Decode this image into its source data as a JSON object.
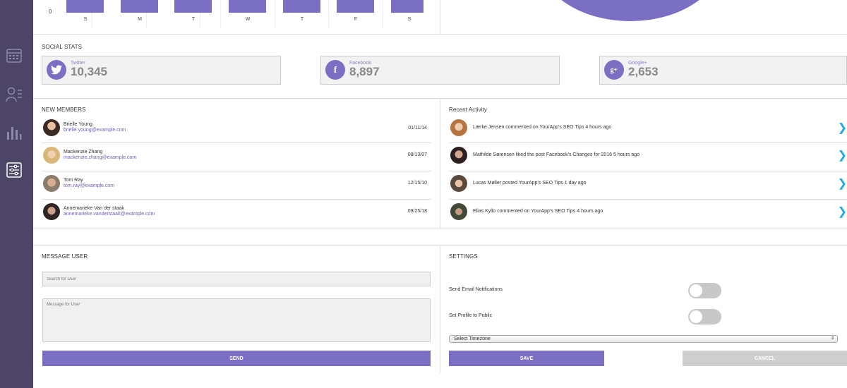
{
  "chart": {
    "y_zero": "0",
    "days": [
      "S",
      "M",
      "T",
      "W",
      "T",
      "F",
      "S"
    ]
  },
  "social": {
    "title": "SOCIAL STATS",
    "cards": [
      {
        "network": "Twitter",
        "count": "10,345",
        "icon": "twitter-icon"
      },
      {
        "network": "Facebook",
        "count": "8,897",
        "icon": "facebook-icon"
      },
      {
        "network": "Google+",
        "count": "2,653",
        "icon": "google-plus-icon"
      }
    ]
  },
  "members": {
    "title": "NEW MEMBERS",
    "items": [
      {
        "name": "Brielle Young",
        "email": "brielle.young@example.com",
        "date": "01/11/14"
      },
      {
        "name": "Mackenzie Zhang",
        "email": "mackenzie.zhang@example.com",
        "date": "08/13/07"
      },
      {
        "name": "Tom Ray",
        "email": "tom.ray@example.com",
        "date": "12/15/10"
      },
      {
        "name": "Annemarieke Van der staak",
        "email": "annemarieke.vanderstaak@example.com",
        "date": "09/25/18"
      }
    ]
  },
  "activity": {
    "title": "Recent Activity",
    "items": [
      {
        "text": "Lærke Jensen commented on YourApp's SEO Tips 4 hours ago"
      },
      {
        "text": "Mathilde Sørensen liked the post Facebook's Changes for 2016 5 hours ago"
      },
      {
        "text": "Lucas Møller posted YourApp's SEO Tips 1 day ago"
      },
      {
        "text": "Elias Kyllo commented on YourApp's SEO Tips 4 hours ago"
      }
    ]
  },
  "message": {
    "title": "MESSAGE USER",
    "search_placeholder": "Search for User",
    "message_placeholder": "Message for User",
    "send_label": "SEND"
  },
  "settings": {
    "title": "SETTINGS",
    "email_label": "Send Email Notifications",
    "profile_label": "Set Profile to Public",
    "timezone_value": "Select Timezone",
    "save_label": "SAVE",
    "cancel_label": "CANCEL"
  },
  "colors": {
    "accent": "#7b6fc4",
    "sidebar": "#4c4566",
    "link_chevron": "#29a8e0"
  }
}
